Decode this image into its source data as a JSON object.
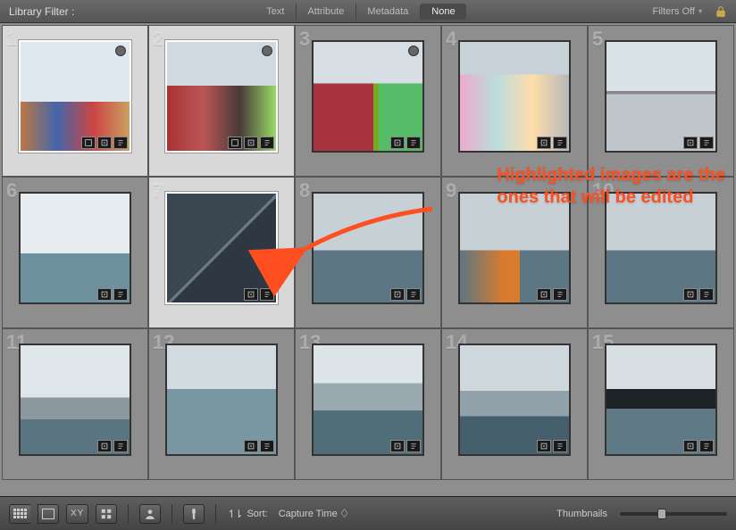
{
  "filter_bar": {
    "label": "Library Filter :",
    "tabs": [
      "Text",
      "Attribute",
      "Metadata",
      "None"
    ],
    "selected_tab": 3,
    "filters_off": "Filters Off"
  },
  "annotation": {
    "line1": "Highlighted images are the",
    "line2": "ones that will be edited"
  },
  "cells": [
    {
      "n": "1",
      "img": "img-a",
      "highlighted": true,
      "flag": true,
      "badges": 3
    },
    {
      "n": "2",
      "img": "img-b",
      "highlighted": true,
      "flag": true,
      "badges": 3
    },
    {
      "n": "3",
      "img": "img-c",
      "highlighted": false,
      "flag": true,
      "badges": 2
    },
    {
      "n": "4",
      "img": "img-d",
      "highlighted": false,
      "flag": false,
      "badges": 2
    },
    {
      "n": "5",
      "img": "img-e",
      "highlighted": false,
      "flag": false,
      "badges": 2
    },
    {
      "n": "6",
      "img": "img-f",
      "highlighted": false,
      "flag": false,
      "badges": 2
    },
    {
      "n": "7",
      "img": "img-g",
      "highlighted": true,
      "flag": false,
      "badges": 2
    },
    {
      "n": "8",
      "img": "img-h",
      "highlighted": false,
      "flag": false,
      "badges": 2
    },
    {
      "n": "9",
      "img": "img-h2",
      "highlighted": false,
      "flag": false,
      "badges": 2
    },
    {
      "n": "10",
      "img": "img-h",
      "highlighted": false,
      "flag": false,
      "badges": 2
    },
    {
      "n": "11",
      "img": "img-i",
      "highlighted": false,
      "flag": false,
      "badges": 2
    },
    {
      "n": "12",
      "img": "img-j",
      "highlighted": false,
      "flag": false,
      "badges": 2
    },
    {
      "n": "13",
      "img": "img-k",
      "highlighted": false,
      "flag": false,
      "badges": 2
    },
    {
      "n": "14",
      "img": "img-l",
      "highlighted": false,
      "flag": false,
      "badges": 2
    },
    {
      "n": "15",
      "img": "img-m",
      "highlighted": false,
      "flag": false,
      "badges": 2
    }
  ],
  "toolbar": {
    "xy_label": "XY",
    "sort_label": "Sort:",
    "sort_value": "Capture Time",
    "thumbnails_label": "Thumbnails"
  }
}
